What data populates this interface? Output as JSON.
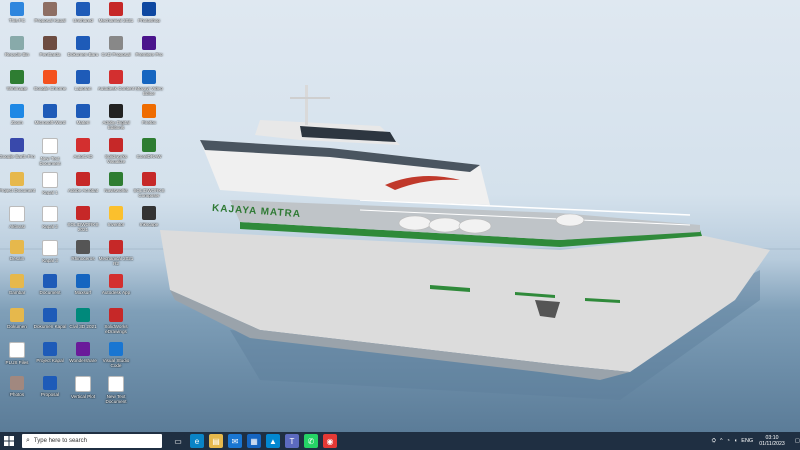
{
  "wallpaper": {
    "ship_name": "KAJAYA MATRA",
    "sky_color": "#dbe5ef",
    "sea_color": "#6d8ea9",
    "hull_color": "#e6e6e6",
    "stripe_color": "#2f8a3a"
  },
  "desktop_icons": [
    {
      "label": "This PC",
      "icon": "pc-icon",
      "color": "#2e86de"
    },
    {
      "label": "Recycle Bin",
      "icon": "recycle-icon",
      "color": "#8aa"
    },
    {
      "label": "Winimage",
      "icon": "disk-icon",
      "color": "#2e7d32"
    },
    {
      "label": "Zoom",
      "icon": "zoom-icon",
      "color": "#1e88e5"
    },
    {
      "label": "Google Earth Pro",
      "icon": "globe-icon",
      "color": "#3949ab"
    },
    {
      "label": "Project Document",
      "icon": "folder-icon",
      "color": "#e6b84c"
    },
    {
      "label": "Aktivasi",
      "icon": "doc-icon",
      "color": "#fff"
    },
    {
      "label": "Desain",
      "icon": "folder-icon",
      "color": "#e6b84c"
    },
    {
      "label": "Gambar",
      "icon": "folder-icon",
      "color": "#e6b84c"
    },
    {
      "label": "Dokumen",
      "icon": "folder-icon",
      "color": "#e6b84c"
    },
    {
      "label": "PLUS Files",
      "icon": "doc-icon",
      "color": "#fff"
    },
    {
      "label": "Photos",
      "icon": "photo-icon",
      "color": "#a1887f"
    },
    {
      "label": "Proposal Kapal",
      "icon": "folder-icon",
      "color": "#8d6e63"
    },
    {
      "label": "PenGarda",
      "icon": "doc-icon",
      "color": "#6d4c41"
    },
    {
      "label": "Google Chrome",
      "icon": "chrome-icon",
      "color": "#f4511e"
    },
    {
      "label": "Microsoft Word",
      "icon": "word-icon",
      "color": "#1e5bb8"
    },
    {
      "label": "New Text Document",
      "icon": "doc-icon",
      "color": "#fff"
    },
    {
      "label": "Kapal 1",
      "icon": "doc-icon",
      "color": "#fff"
    },
    {
      "label": "Kapal 2",
      "icon": "doc-icon",
      "color": "#fff"
    },
    {
      "label": "Kapal 3",
      "icon": "doc-icon",
      "color": "#fff"
    },
    {
      "label": "Document",
      "icon": "word-icon",
      "color": "#1e5bb8"
    },
    {
      "label": "Dokumen Kapal",
      "icon": "word-icon",
      "color": "#1e5bb8"
    },
    {
      "label": "Project Kapal",
      "icon": "word-icon",
      "color": "#1e5bb8"
    },
    {
      "label": "Proposal",
      "icon": "word-icon",
      "color": "#1e5bb8"
    },
    {
      "label": "Unshared",
      "icon": "word-icon",
      "color": "#1e5bb8"
    },
    {
      "label": "Dokumen Baru",
      "icon": "word-icon",
      "color": "#1e5bb8"
    },
    {
      "label": "Laporan",
      "icon": "word-icon",
      "color": "#1e5bb8"
    },
    {
      "label": "Materi",
      "icon": "word-icon",
      "color": "#1e5bb8"
    },
    {
      "label": "AutoCAD",
      "icon": "autocad-icon",
      "color": "#d32f2f"
    },
    {
      "label": "Adobe Acrobat",
      "icon": "pdf-icon",
      "color": "#c62828"
    },
    {
      "label": "SOLIDWORKS 2021",
      "icon": "sw-icon",
      "color": "#c62828"
    },
    {
      "label": "Rhinoceros",
      "icon": "rhino-icon",
      "color": "#555"
    },
    {
      "label": "Maxsurf",
      "icon": "app-icon",
      "color": "#1565c0"
    },
    {
      "label": "Civil 3D 2021",
      "icon": "civil-icon",
      "color": "#00897b"
    },
    {
      "label": "Wondershare",
      "icon": "app-icon",
      "color": "#6a1b9a"
    },
    {
      "label": "Vertical Plot",
      "icon": "app-icon",
      "color": "#fff"
    },
    {
      "label": "Mechanical 2021",
      "icon": "mech-icon",
      "color": "#c62828"
    },
    {
      "label": "CAD Proposal",
      "icon": "cad-icon",
      "color": "#888"
    },
    {
      "label": "Autodesk Content",
      "icon": "autocad-icon",
      "color": "#d32f2f"
    },
    {
      "label": "Adobe Digital Editions",
      "icon": "app-icon",
      "color": "#222"
    },
    {
      "label": "Solidworks Visualize",
      "icon": "sw-icon",
      "color": "#c62828"
    },
    {
      "label": "Navisworks",
      "icon": "app-icon",
      "color": "#2e7d32"
    },
    {
      "label": "Inventor",
      "icon": "app-icon",
      "color": "#fbc02d"
    },
    {
      "label": "Mechanical 2021 R2",
      "icon": "mech-icon",
      "color": "#c62828"
    },
    {
      "label": "Autodesk App",
      "icon": "autocad-icon",
      "color": "#d32f2f"
    },
    {
      "label": "SolidWorks eDrawings",
      "icon": "sw-icon",
      "color": "#c62828"
    },
    {
      "label": "Visual Studio Code",
      "icon": "vscode-icon",
      "color": "#1976d2"
    },
    {
      "label": "New Text Document",
      "icon": "doc-icon",
      "color": "#fff"
    },
    {
      "label": "Photoshop",
      "icon": "ps-icon",
      "color": "#0d47a1"
    },
    {
      "label": "Premiere Pro",
      "icon": "pr-icon",
      "color": "#4a148c"
    },
    {
      "label": "Movavi Video Editor",
      "icon": "app-icon",
      "color": "#1565c0"
    },
    {
      "label": "Firefox",
      "icon": "firefox-icon",
      "color": "#ef6c00"
    },
    {
      "label": "CorelDRAW",
      "icon": "app-icon",
      "color": "#2e7d32"
    },
    {
      "label": "SOLIDWORKS Composer",
      "icon": "sw-icon",
      "color": "#c62828"
    },
    {
      "label": "Inkscape",
      "icon": "app-icon",
      "color": "#333"
    }
  ],
  "taskbar": {
    "search_placeholder": "Type here to search",
    "apps": [
      {
        "name": "task-view",
        "glyph": "▭",
        "color": "#1f2f42"
      },
      {
        "name": "edge",
        "glyph": "e",
        "color": "#0a84c6"
      },
      {
        "name": "file-explorer",
        "glyph": "▤",
        "color": "#e6b84c"
      },
      {
        "name": "mail",
        "glyph": "✉",
        "color": "#1976d2"
      },
      {
        "name": "store",
        "glyph": "▦",
        "color": "#1565c0"
      },
      {
        "name": "photos",
        "glyph": "▲",
        "color": "#0288d1"
      },
      {
        "name": "teams",
        "glyph": "T",
        "color": "#5c6bc0"
      },
      {
        "name": "whatsapp",
        "glyph": "✆",
        "color": "#25d366"
      },
      {
        "name": "chrome",
        "glyph": "◉",
        "color": "#e53935"
      }
    ],
    "tray": {
      "language": "ENG",
      "time": "03:10",
      "date": "01/11/2023"
    }
  }
}
